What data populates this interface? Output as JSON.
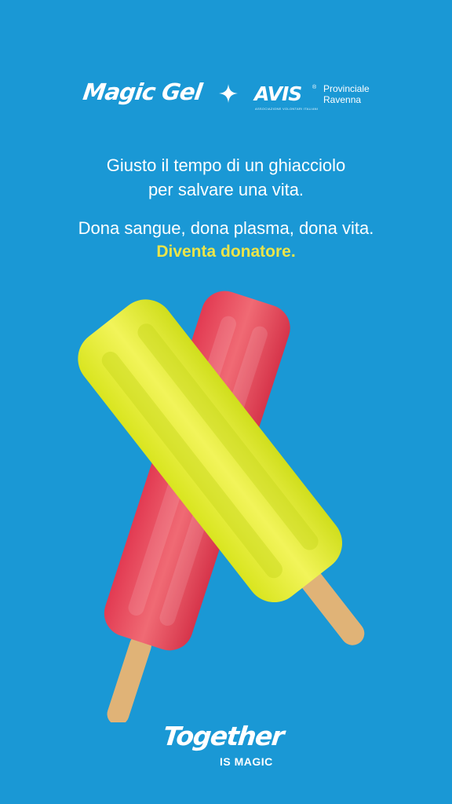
{
  "brand": {
    "magic_gel": "Magic Gel",
    "avis": "AVIS",
    "avis_reg": "®",
    "avis_subtitle": "ASSOCIAZIONE VOLONTARI ITALIANI",
    "avis_provincial_line1": "Provinciale",
    "avis_provincial_line2": "Ravenna"
  },
  "message": {
    "line1": "Giusto il tempo di un ghiacciolo",
    "line2": "per salvare una vita.",
    "line3": "Dona sangue, dona plasma, dona vita.",
    "cta": "Diventa donatore."
  },
  "footer": {
    "together": "Together",
    "is_magic": "IS MAGIC"
  },
  "colors": {
    "background": "#1a98d5",
    "cta": "#eae44a",
    "yellow_popsicle": "#e6ec34",
    "red_popsicle": "#e8455a",
    "stick": "#e0b377"
  },
  "icons": [
    "sparkle-icon"
  ]
}
